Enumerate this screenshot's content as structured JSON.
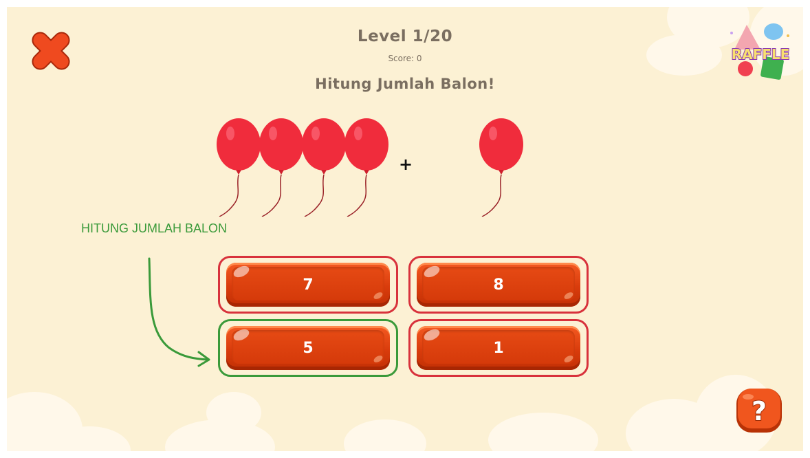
{
  "header": {
    "level": "Level 1/20",
    "score": "Score: 0",
    "instruction": "Hitung Jumlah Balon!"
  },
  "problem": {
    "left_balloons": 4,
    "operator": "+",
    "right_balloons": 1,
    "balloon_color": "#f02c3c"
  },
  "answers": [
    {
      "label": "7",
      "highlight": "wrong"
    },
    {
      "label": "8",
      "highlight": "wrong"
    },
    {
      "label": "5",
      "highlight": "correct"
    },
    {
      "label": "1",
      "highlight": "wrong"
    }
  ],
  "annotation": {
    "label": "HITUNG JUMLAH BALON"
  },
  "logo": {
    "text": "RAFFLE"
  },
  "icons": {
    "close": "close-icon",
    "help": "question-mark-icon"
  },
  "colors": {
    "background": "#fcf1d4",
    "text": "#7a6e60",
    "button": "#d93c0c",
    "correct_outline": "#3a9a3a",
    "wrong_outline": "#d8323c"
  }
}
